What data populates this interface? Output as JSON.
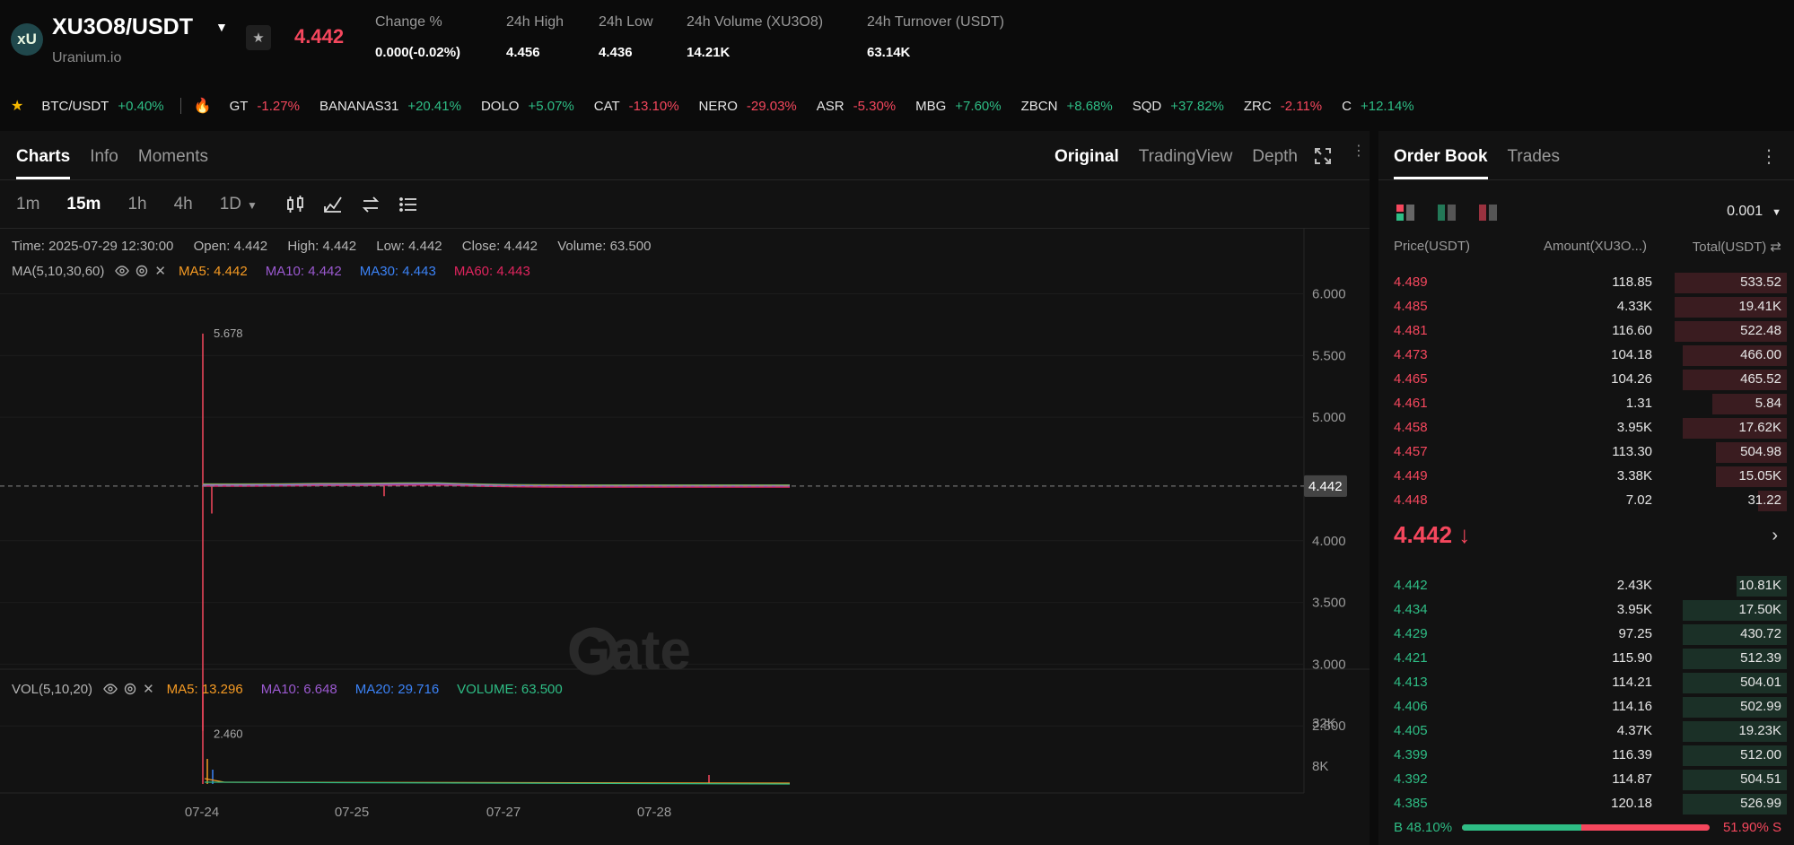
{
  "header": {
    "logo_text": "xU",
    "pair": "XU3O8/USDT",
    "sub": "Uranium.io",
    "price": "4.442",
    "stats": [
      {
        "label": "Change %",
        "value": "0.000(-0.02%)",
        "color": "red"
      },
      {
        "label": "24h High",
        "value": "4.456",
        "color": "white"
      },
      {
        "label": "24h Low",
        "value": "4.436",
        "color": "white"
      },
      {
        "label": "24h Volume (XU3O8)",
        "value": "14.21K",
        "color": "white"
      },
      {
        "label": "24h Turnover (USDT)",
        "value": "63.14K",
        "color": "white"
      }
    ]
  },
  "ticker": [
    {
      "sym": "BTC/USDT",
      "chg": "+0.40%",
      "dir": "up"
    },
    {
      "sym": "GT",
      "chg": "-1.27%",
      "dir": "down"
    },
    {
      "sym": "BANANAS31",
      "chg": "+20.41%",
      "dir": "up"
    },
    {
      "sym": "DOLO",
      "chg": "+5.07%",
      "dir": "up"
    },
    {
      "sym": "CAT",
      "chg": "-13.10%",
      "dir": "down"
    },
    {
      "sym": "NERO",
      "chg": "-29.03%",
      "dir": "down"
    },
    {
      "sym": "ASR",
      "chg": "-5.30%",
      "dir": "down"
    },
    {
      "sym": "MBG",
      "chg": "+7.60%",
      "dir": "up"
    },
    {
      "sym": "ZBCN",
      "chg": "+8.68%",
      "dir": "up"
    },
    {
      "sym": "SQD",
      "chg": "+37.82%",
      "dir": "up"
    },
    {
      "sym": "ZRC",
      "chg": "-2.11%",
      "dir": "down"
    },
    {
      "sym": "C",
      "chg": "+12.14%",
      "dir": "up"
    }
  ],
  "chart_tabs": [
    "Charts",
    "Info",
    "Moments"
  ],
  "view_tabs": [
    "Original",
    "TradingView",
    "Depth"
  ],
  "intervals": [
    "1m",
    "15m",
    "1h",
    "4h",
    "1D"
  ],
  "info": {
    "time": "Time: 2025-07-29 12:30:00",
    "open": "Open: 4.442",
    "high": "High: 4.442",
    "low": "Low: 4.442",
    "close": "Close: 4.442",
    "volume": "Volume: 63.500"
  },
  "ma": {
    "label": "MA(5,10,30,60)",
    "ma5": "MA5: 4.442",
    "ma10": "MA10: 4.442",
    "ma30": "MA30: 4.443",
    "ma60": "MA60: 4.443"
  },
  "vol": {
    "label": "VOL(5,10,20)",
    "ma5": "MA5: 13.296",
    "ma10": "MA10: 6.648",
    "ma20": "MA20: 29.716",
    "volume": "VOLUME: 63.500"
  },
  "colors": {
    "up": "#2ebd85",
    "down": "#f5475d",
    "ma5": "#f59a23",
    "ma10": "#9b59d0",
    "ma30": "#3b82f6",
    "ma60": "#e0245e"
  },
  "chart_data": {
    "type": "line",
    "y_ticks": [
      "6.000",
      "5.500",
      "5.000",
      "4.000",
      "3.500",
      "3.000",
      "2.500"
    ],
    "ylim": [
      2.0,
      6.2
    ],
    "x_ticks": [
      "07-24",
      "07-25",
      "07-27",
      "07-28"
    ],
    "current_price_label": "4.442",
    "high_label": "5.678",
    "low_label": "2.460",
    "vol_ticks": [
      "32K",
      "8K"
    ],
    "watermark": "Gate",
    "series": [
      {
        "values": [
          4.45,
          4.45,
          4.452,
          4.455,
          4.455,
          4.458,
          4.46,
          4.45,
          4.445,
          4.443,
          4.442,
          4.442,
          4.442,
          4.442,
          4.442,
          4.442
        ]
      }
    ]
  },
  "orderbook": {
    "tabs": [
      "Order Book",
      "Trades"
    ],
    "precision": "0.001",
    "headers": [
      "Price(USDT)",
      "Amount(XU3O...)",
      "Total(USDT)"
    ],
    "asks": [
      {
        "p": "4.489",
        "a": "118.85",
        "t": "533.52",
        "depth": 0.27
      },
      {
        "p": "4.485",
        "a": "4.33K",
        "t": "19.41K",
        "depth": 0.27
      },
      {
        "p": "4.481",
        "a": "116.60",
        "t": "522.48",
        "depth": 0.27
      },
      {
        "p": "4.473",
        "a": "104.18",
        "t": "466.00",
        "depth": 0.25
      },
      {
        "p": "4.465",
        "a": "104.26",
        "t": "465.52",
        "depth": 0.25
      },
      {
        "p": "4.461",
        "a": "1.31",
        "t": "5.84",
        "depth": 0.18
      },
      {
        "p": "4.458",
        "a": "3.95K",
        "t": "17.62K",
        "depth": 0.25
      },
      {
        "p": "4.457",
        "a": "113.30",
        "t": "504.98",
        "depth": 0.17
      },
      {
        "p": "4.449",
        "a": "3.38K",
        "t": "15.05K",
        "depth": 0.17
      },
      {
        "p": "4.448",
        "a": "7.02",
        "t": "31.22",
        "depth": 0.07
      }
    ],
    "mid": "4.442 ↓",
    "bids": [
      {
        "p": "4.442",
        "a": "2.43K",
        "t": "10.81K",
        "depth": 0.12
      },
      {
        "p": "4.434",
        "a": "3.95K",
        "t": "17.50K",
        "depth": 0.25
      },
      {
        "p": "4.429",
        "a": "97.25",
        "t": "430.72",
        "depth": 0.25
      },
      {
        "p": "4.421",
        "a": "115.90",
        "t": "512.39",
        "depth": 0.25
      },
      {
        "p": "4.413",
        "a": "114.21",
        "t": "504.01",
        "depth": 0.25
      },
      {
        "p": "4.406",
        "a": "114.16",
        "t": "502.99",
        "depth": 0.25
      },
      {
        "p": "4.405",
        "a": "4.37K",
        "t": "19.23K",
        "depth": 0.25
      },
      {
        "p": "4.399",
        "a": "116.39",
        "t": "512.00",
        "depth": 0.25
      },
      {
        "p": "4.392",
        "a": "114.87",
        "t": "504.51",
        "depth": 0.25
      },
      {
        "p": "4.385",
        "a": "120.18",
        "t": "526.99",
        "depth": 0.25
      }
    ],
    "buy_ratio": "B 48.10%",
    "sell_ratio": "51.90% S",
    "buy_fraction": 0.481
  }
}
